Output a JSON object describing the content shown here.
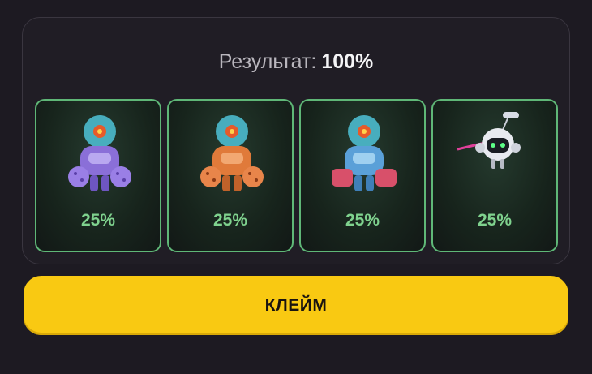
{
  "result": {
    "label": "Результат:",
    "value": "100%"
  },
  "cards": [
    {
      "name": "purple-mech",
      "percent": "25%",
      "color": "#8a6fd8"
    },
    {
      "name": "orange-mech",
      "percent": "25%",
      "color": "#e07a3a"
    },
    {
      "name": "blue-mech",
      "percent": "25%",
      "color": "#5aa0d8"
    },
    {
      "name": "robot-drone",
      "percent": "25%",
      "color": "#e8eaf0"
    }
  ],
  "claim_button": {
    "label": "КЛЕЙМ",
    "color": "#f9c912"
  }
}
